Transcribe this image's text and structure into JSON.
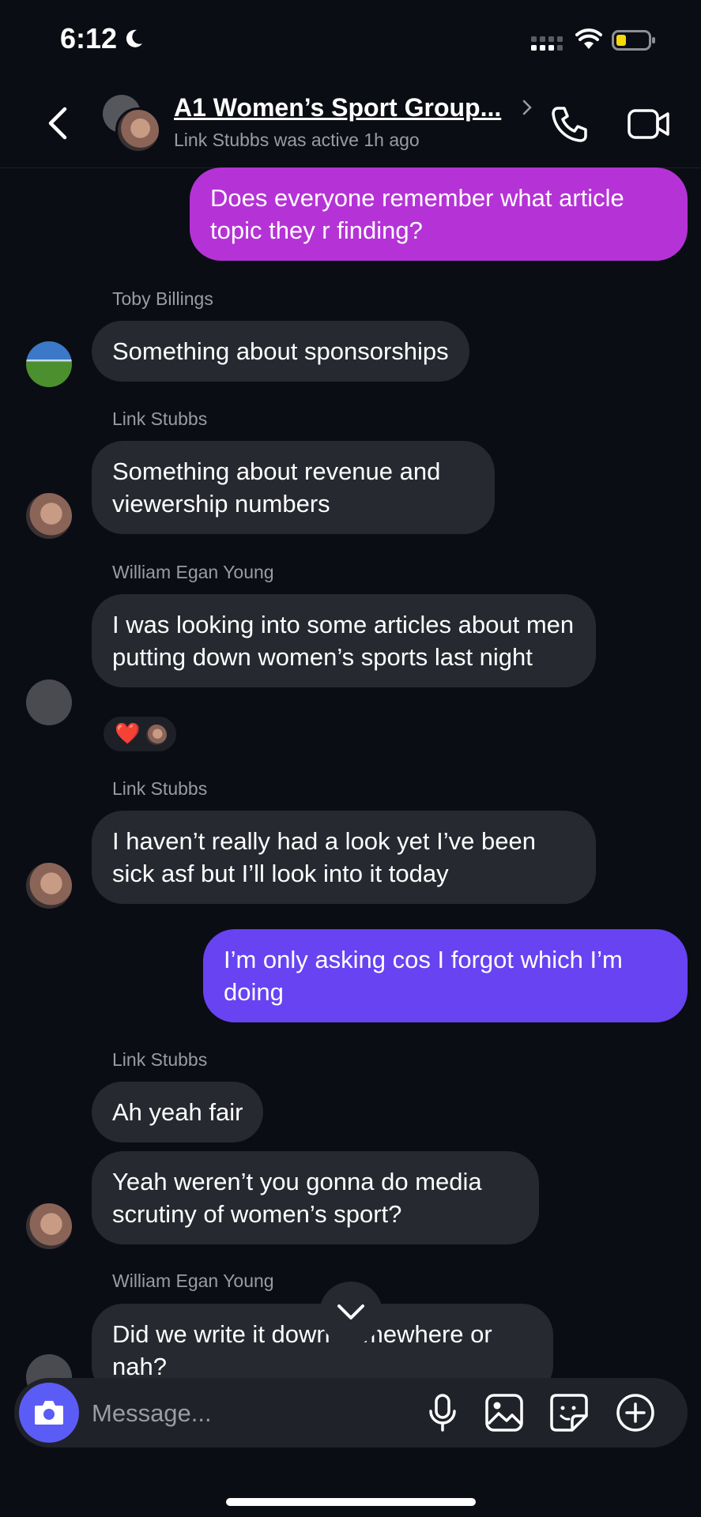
{
  "status_bar": {
    "time": "6:12"
  },
  "header": {
    "title": "A1 Women’s Sport Group...",
    "subtitle": "Link Stubbs was active 1h ago"
  },
  "messages": {
    "m1": "Does everyone remember what article topic they r finding?",
    "s2": "Toby Billings",
    "m2": "Something about sponsorships",
    "s3": "Link Stubbs",
    "m3": "Something about revenue and viewership numbers",
    "s4": "William Egan Young",
    "m4": "I was looking into some articles about men putting down women’s sports last night",
    "s5": "Link Stubbs",
    "m5": "I haven’t really had a look yet I’ve been sick asf but I’ll look into it today",
    "m6": "I’m only asking cos I forgot which I’m doing",
    "s7": "Link Stubbs",
    "m7": "Ah yeah fair",
    "m8": "Yeah weren’t you gonna do media scrutiny of women’s sport?",
    "s9": "William Egan Young",
    "m9": "Did we write it down somewhere or nah?"
  },
  "reaction": {
    "emoji": "❤️"
  },
  "composer": {
    "placeholder": "Message..."
  },
  "colors": {
    "background": "#0b0d14",
    "incoming_bubble": "#262930",
    "outgoing_bubble_1": "#b533d6",
    "outgoing_bubble_2": "#6743f2",
    "camera_button": "#5b5cf6",
    "battery_low": "#f5d90a"
  },
  "icons": [
    "moon-icon",
    "signal-icon",
    "wifi-icon",
    "battery-icon",
    "back-icon",
    "chevron-right-icon",
    "phone-icon",
    "video-icon",
    "chevron-down-icon",
    "camera-icon",
    "microphone-icon",
    "image-icon",
    "sticker-icon",
    "plus-icon"
  ]
}
